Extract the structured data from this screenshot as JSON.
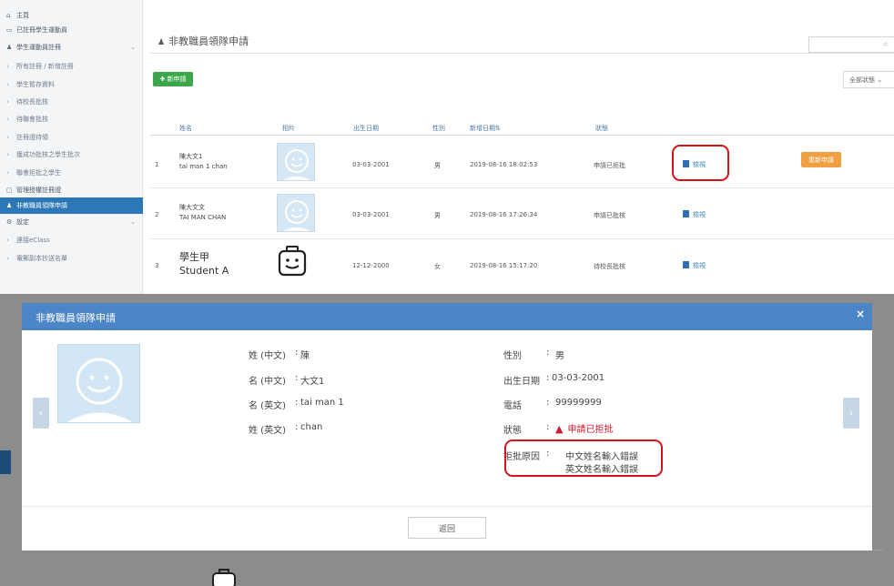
{
  "sidebar": {
    "items": [
      {
        "icon": "home-icon",
        "glyph": "⌂",
        "label": "主頁",
        "sub": false,
        "active": false
      },
      {
        "icon": "card-icon",
        "glyph": "▭",
        "label": "已註冊學生運動員",
        "sub": false,
        "active": false
      },
      {
        "icon": "user-icon",
        "glyph": "♟",
        "label": "學生運動員註冊",
        "sub": false,
        "active": false,
        "expandable": true
      },
      {
        "icon": "chevron-right-icon",
        "glyph": "›",
        "label": "所有註冊 / 新增註冊",
        "sub": true,
        "active": false
      },
      {
        "icon": "chevron-right-icon",
        "glyph": "›",
        "label": "學生暫存資料",
        "sub": true,
        "active": false
      },
      {
        "icon": "chevron-right-icon",
        "glyph": "›",
        "label": "待校長批核",
        "sub": true,
        "active": false
      },
      {
        "icon": "chevron-right-icon",
        "glyph": "›",
        "label": "待聯會批核",
        "sub": true,
        "active": false
      },
      {
        "icon": "chevron-right-icon",
        "glyph": "›",
        "label": "註冊證待領",
        "sub": true,
        "active": false
      },
      {
        "icon": "chevron-right-icon",
        "glyph": "›",
        "label": "獲成功批核之學生批次",
        "sub": true,
        "active": false
      },
      {
        "icon": "chevron-right-icon",
        "glyph": "›",
        "label": "聯會拒批之學生",
        "sub": true,
        "active": false
      },
      {
        "icon": "document-icon",
        "glyph": "▢",
        "label": "管理授權註冊證",
        "sub": false,
        "active": false
      },
      {
        "icon": "user-icon",
        "glyph": "♟",
        "label": "非教職員領隊申請",
        "sub": false,
        "active": true
      },
      {
        "icon": "gear-icon",
        "glyph": "⚙",
        "label": "設定",
        "sub": false,
        "active": false,
        "expandable": true
      },
      {
        "icon": "chevron-right-icon",
        "glyph": "›",
        "label": "連接eClass",
        "sub": true,
        "active": false
      },
      {
        "icon": "chevron-right-icon",
        "glyph": "›",
        "label": "電郵副本抄送名單",
        "sub": true,
        "active": false
      }
    ]
  },
  "header": {
    "title": "非教職員領隊申請",
    "new_button": "✚ 新申請",
    "status_filter": "全部狀態 ⌄"
  },
  "table": {
    "columns": {
      "name": "姓名",
      "photo": "相片",
      "dob": "出生日期",
      "gender": "性別",
      "created": "新增日期⇅",
      "status": "狀態"
    },
    "rows": [
      {
        "no": "1",
        "name_zh": "陳大文1",
        "name_en": "tai man 1 chan",
        "photo": "smiley",
        "dob": "03-03-2001",
        "gender": "男",
        "created": "2019-08-16 18:02:53",
        "status": "申請已拒批",
        "view": "檢視",
        "action": "重新申請"
      },
      {
        "no": "2",
        "name_zh": "陳大文文",
        "name_en": "TAI MAN CHAN",
        "photo": "smiley",
        "dob": "03-03-2001",
        "gender": "男",
        "created": "2019-08-16 17:26:34",
        "status": "申請已批核",
        "view": "檢視"
      },
      {
        "no": "3",
        "name_zh": "學生甲",
        "name_en": "Student A",
        "photo": "robot",
        "dob": "12-12-2000",
        "gender": "女",
        "created": "2019-08-16 15:17:20",
        "status": "待校長批核",
        "view": "檢視"
      }
    ]
  },
  "modal": {
    "title": "非教職員領隊申請",
    "close": "×",
    "left": [
      {
        "label": "姓 (中文)",
        "value": "陳"
      },
      {
        "label": "名 (中文)",
        "value": "大文1"
      },
      {
        "label": "名 (英文)",
        "value": "tai man 1"
      },
      {
        "label": "姓 (英文)",
        "value": "chan"
      }
    ],
    "right": [
      {
        "label": "性別",
        "value": "男"
      },
      {
        "label": "出生日期",
        "value": "03-03-2001"
      },
      {
        "label": "電話",
        "value": "99999999"
      },
      {
        "label": "狀態",
        "value": "申請已拒批"
      }
    ],
    "reject_reason_label": "拒批原因",
    "reject_reasons": [
      "中文姓名輸入錯誤",
      "英文姓名輸入錯誤"
    ],
    "back_button": "返回",
    "prev_arrow": "‹",
    "next_arrow": "›"
  },
  "colors": {
    "header_blue": "#4b85c5",
    "active_blue": "#2c77b5",
    "new_green": "#3aa84a",
    "reapply_orange": "#f0a040",
    "reject_red": "#d0192b",
    "highlight_red": "#d3141b"
  }
}
